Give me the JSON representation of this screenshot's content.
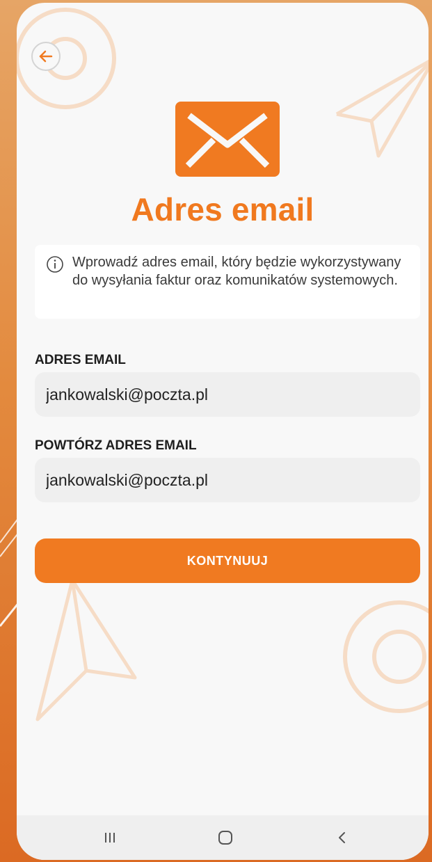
{
  "screen": {
    "title": "Adres email",
    "info_text": "Wprowadź adres email, który będzie wykorzystywany do wysyłania faktur oraz komunikatów systemowych."
  },
  "form": {
    "email_label": "ADRES EMAIL",
    "email_value": "jankowalski@poczta.pl",
    "repeat_label": "POWTÓRZ ADRES EMAIL",
    "repeat_value": "jankowalski@poczta.pl"
  },
  "actions": {
    "continue_label": "KONTYNUUJ"
  },
  "icons": {
    "back": "arrow-left-icon",
    "mail": "envelope-icon",
    "info": "info-circle-icon",
    "nav_recents": "recents-icon",
    "nav_home": "home-icon",
    "nav_back": "chevron-left-icon"
  },
  "colors": {
    "accent": "#f07a21",
    "background_gradient_top": "#e6a566",
    "background_gradient_bottom": "#db6a23",
    "screen_bg": "#f8f8f8",
    "input_bg": "#efefef"
  }
}
